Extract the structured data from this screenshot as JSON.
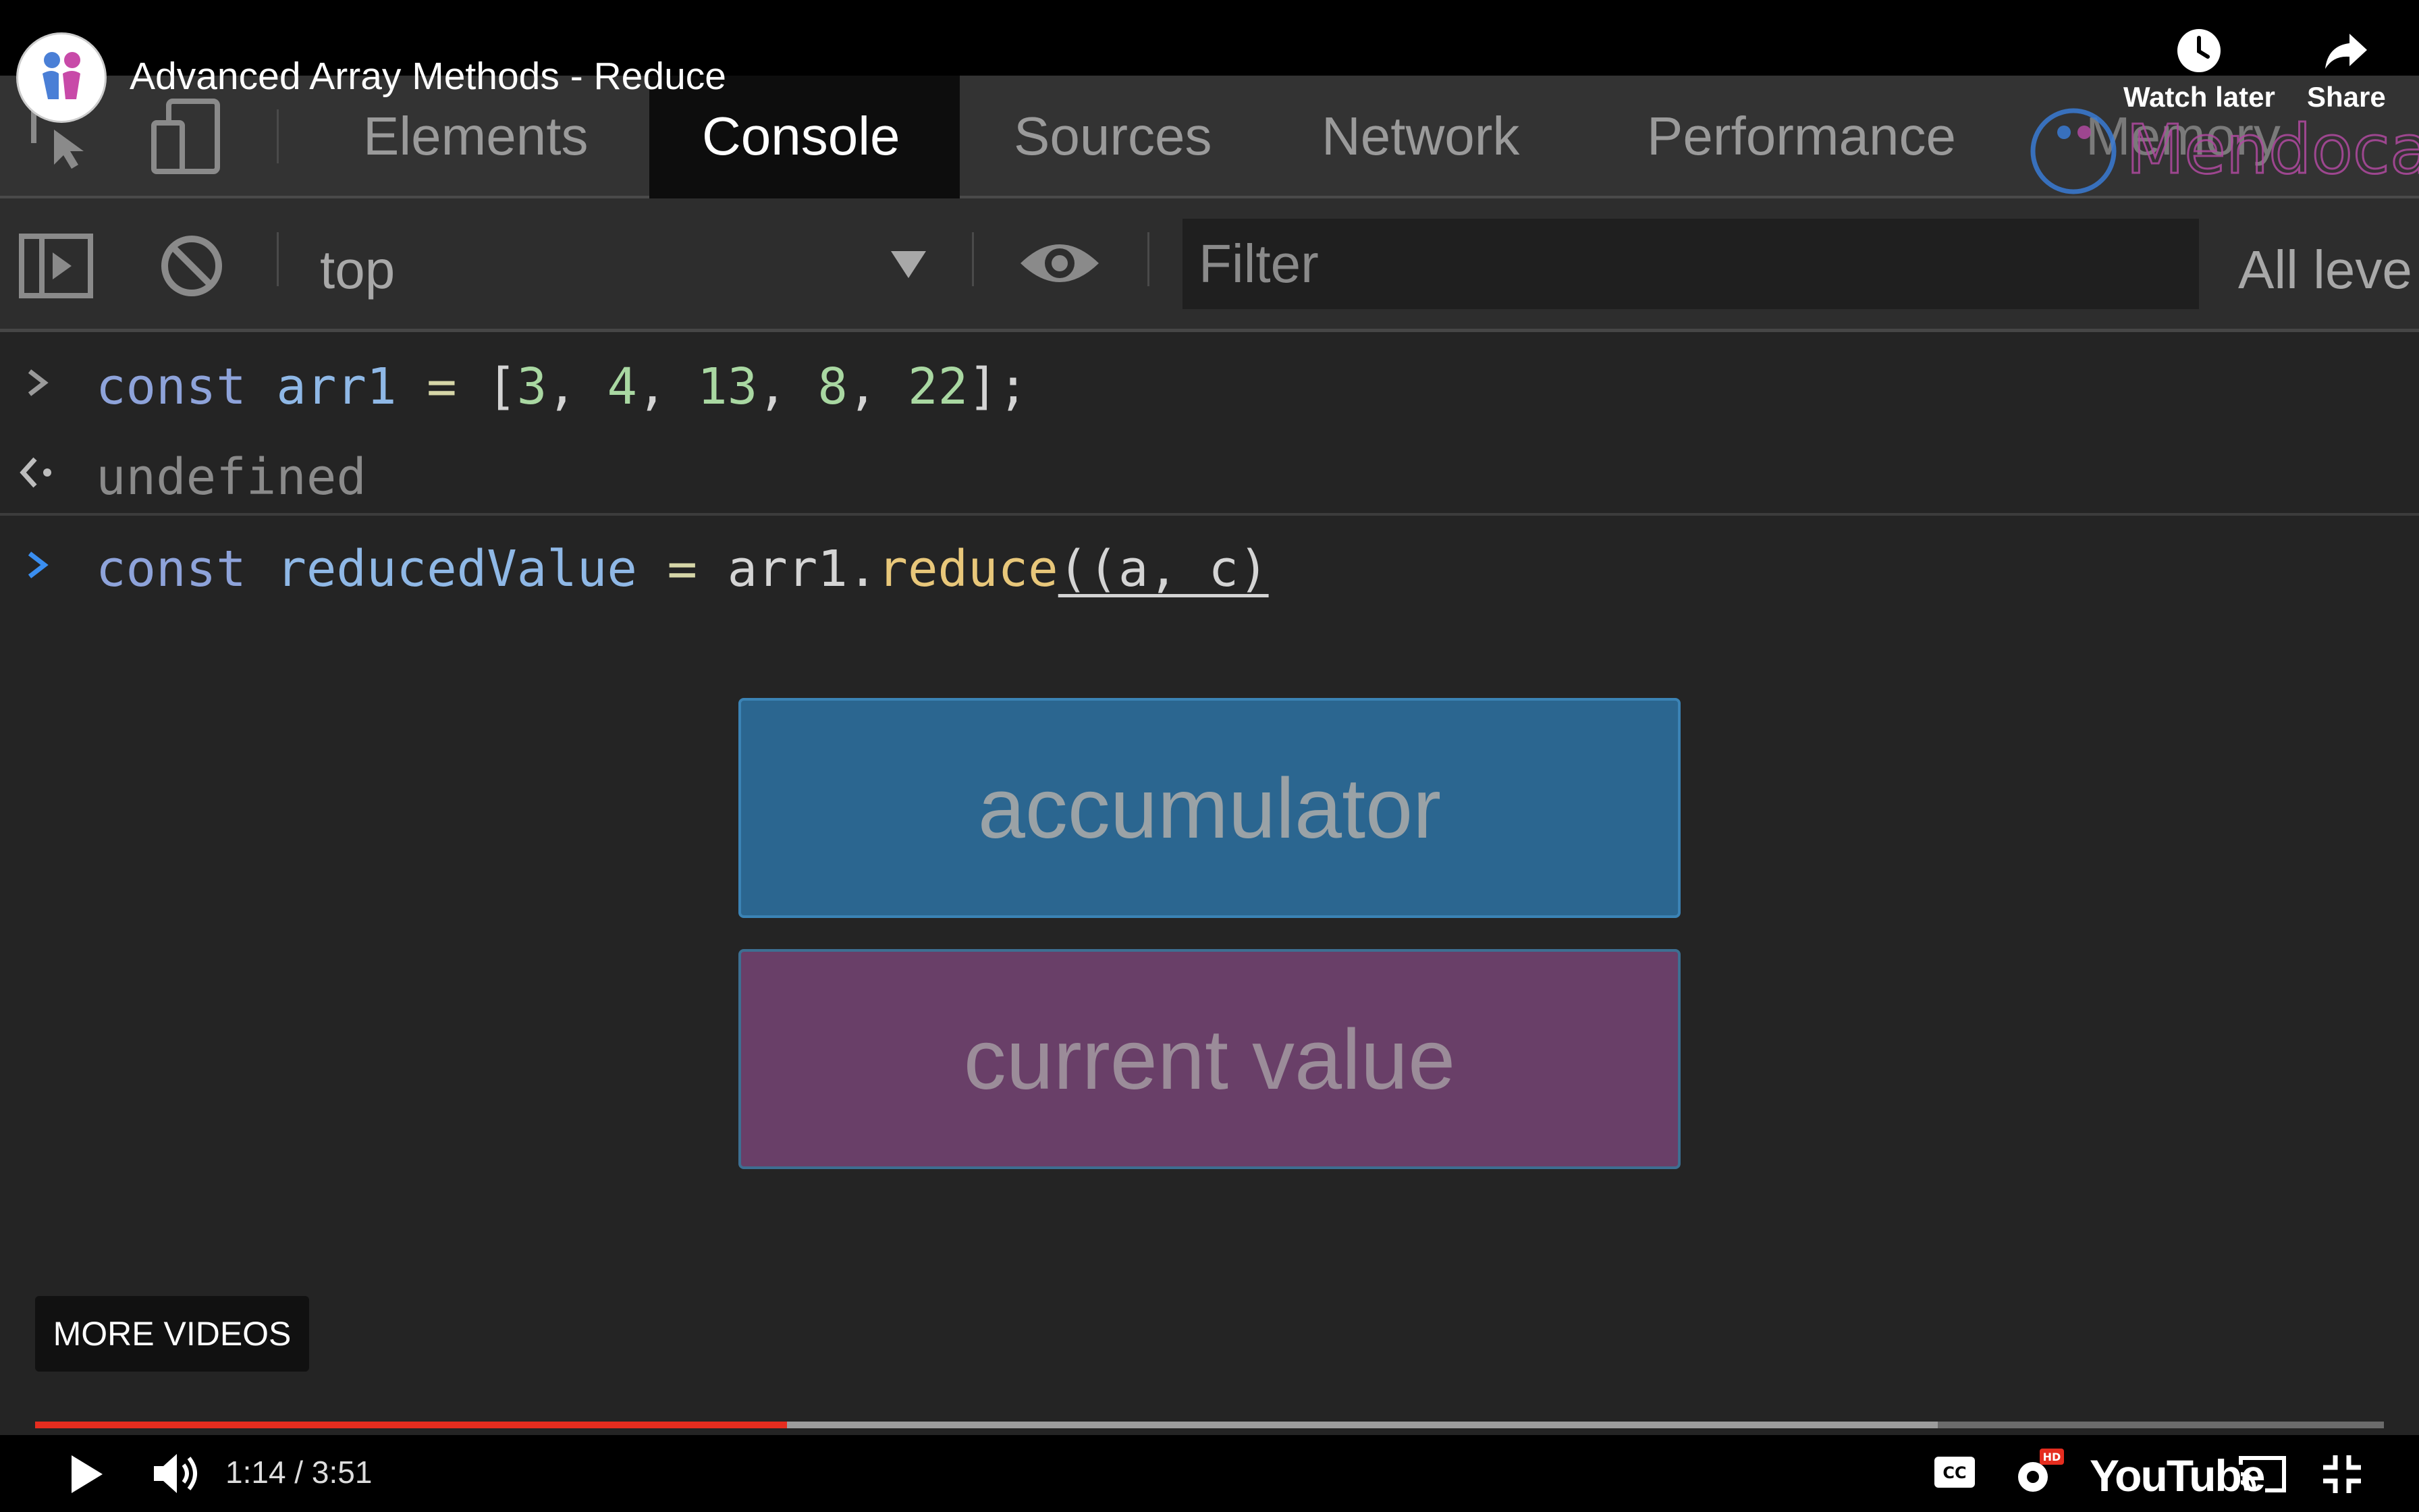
{
  "video": {
    "title": "Advanced Array Methods - Reduce",
    "watch_later_label": "Watch later",
    "share_label": "Share",
    "more_videos_label": "MORE VIDEOS",
    "time_text": "1:14 / 3:51",
    "progress": 0.32,
    "buffered": 0.81,
    "brand_watermark": "Mendocamp"
  },
  "devtools": {
    "tabs": [
      "Elements",
      "Console",
      "Sources",
      "Network",
      "Performance",
      "Memory"
    ],
    "active_tab": "Console",
    "context": "top",
    "filter_placeholder": "Filter",
    "levels_label": "All leve"
  },
  "console": {
    "line1": {
      "keyword": "const",
      "name": "arr1",
      "op": "=",
      "open": "[",
      "values": [
        "3",
        "4",
        "13",
        "8",
        "22"
      ],
      "close": "];"
    },
    "result1": "undefined",
    "line2": {
      "keyword": "const",
      "name": "reducedValue",
      "op": "=",
      "object": "arr1.",
      "method": "reduce",
      "args": "((a, c)"
    }
  },
  "overlay": {
    "accumulator_label": "accumulator",
    "current_value_label": "current value"
  },
  "colors": {
    "accumulator_bg": "#2b6690",
    "current_value_bg": "#693f68",
    "progress_red": "#e52d1f"
  },
  "icons": [
    "channel-avatar",
    "clock-icon",
    "share-arrow-icon",
    "inspect-element-icon",
    "device-toolbar-icon",
    "sidebar-toggle-icon",
    "clear-console-icon",
    "eye-icon",
    "play-icon",
    "volume-icon",
    "captions-icon",
    "settings-hd-icon",
    "cast-icon",
    "exit-fullscreen-icon"
  ]
}
